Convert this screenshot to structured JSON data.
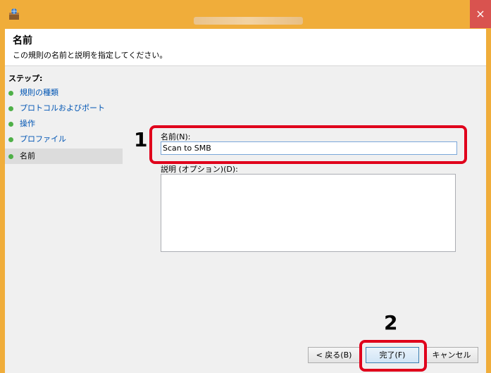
{
  "window": {
    "close_glyph": "×",
    "accent_color": "#f0ad3a",
    "close_color": "#d9534f"
  },
  "header": {
    "title": "名前",
    "description": "この規則の名前と説明を指定してください。"
  },
  "steps": {
    "label": "ステップ:",
    "items": [
      {
        "label": "規則の種類"
      },
      {
        "label": "プロトコルおよびポート"
      },
      {
        "label": "操作"
      },
      {
        "label": "プロファイル"
      },
      {
        "label": "名前"
      }
    ]
  },
  "form": {
    "name_label": "名前(N):",
    "name_value": "Scan to SMB",
    "desc_label": "説明 (オプション)(D):",
    "desc_value": ""
  },
  "buttons": {
    "back": "< 戻る(B)",
    "finish": "完了(F)",
    "cancel": "キャンセル"
  },
  "annotations": {
    "callout_1": "1",
    "callout_2": "2",
    "color": "#e0001b"
  }
}
